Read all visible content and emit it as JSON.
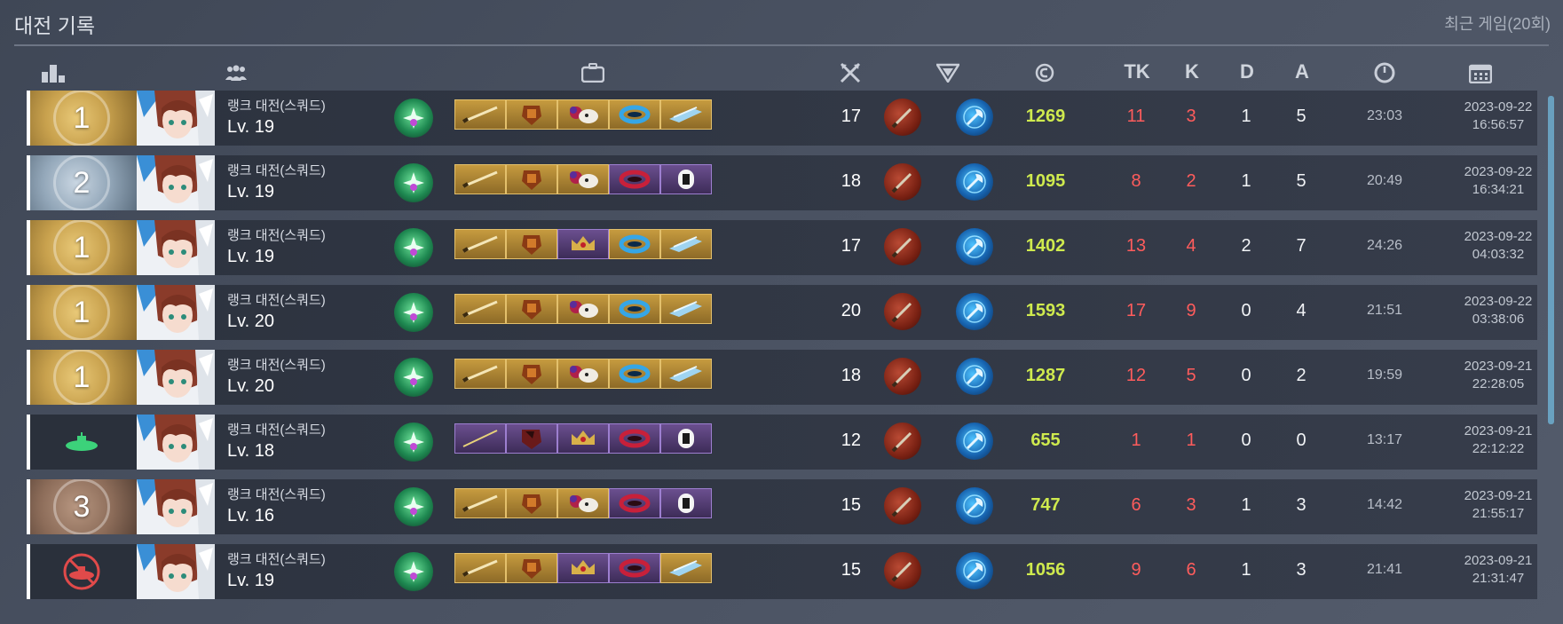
{
  "title": "대전 기록",
  "recent": "최근 게임(20회)",
  "headers": {
    "rank_icon": "rank-podium-icon",
    "players_icon": "team-icon",
    "items_icon": "briefcase-icon",
    "tier_icon": "crossed-swords-icon",
    "weapon_icon": "emblem-icon",
    "credit_icon": "credit-icon",
    "tk": "TK",
    "k": "K",
    "d": "D",
    "a": "A",
    "time_icon": "clock-icon",
    "date_icon": "calendar-icon"
  },
  "colors": {
    "credit": "#cfea4e",
    "kill": "#ff5c5c",
    "gold_rank": "#c9a24e",
    "silver_rank": "#93a7b9",
    "bronze_rank": "#8c6c59",
    "win_sub": "#3cd27a",
    "lose_sub": "#e04a4a"
  },
  "rows": [
    {
      "rank": "1",
      "rank_style": "gold",
      "mode": "랭크 대전(스쿼드)",
      "level": "Lv. 19",
      "items": [
        "gold",
        "gold",
        "gold",
        "gold",
        "gold"
      ],
      "tier": "17",
      "credit": "1269",
      "tk": "11",
      "k": "3",
      "d": "1",
      "a": "5",
      "time": "23:03",
      "date": "2023-09-22",
      "clock": "16:56:57"
    },
    {
      "rank": "2",
      "rank_style": "silver",
      "mode": "랭크 대전(스쿼드)",
      "level": "Lv. 19",
      "items": [
        "gold",
        "gold",
        "gold",
        "purple",
        "purple"
      ],
      "tier": "18",
      "credit": "1095",
      "tk": "8",
      "k": "2",
      "d": "1",
      "a": "5",
      "time": "20:49",
      "date": "2023-09-22",
      "clock": "16:34:21"
    },
    {
      "rank": "1",
      "rank_style": "gold",
      "mode": "랭크 대전(스쿼드)",
      "level": "Lv. 19",
      "items": [
        "gold",
        "gold",
        "purple",
        "gold",
        "gold"
      ],
      "tier": "17",
      "credit": "1402",
      "tk": "13",
      "k": "4",
      "d": "2",
      "a": "7",
      "time": "24:26",
      "date": "2023-09-22",
      "clock": "04:03:32"
    },
    {
      "rank": "1",
      "rank_style": "gold",
      "mode": "랭크 대전(스쿼드)",
      "level": "Lv. 20",
      "items": [
        "gold",
        "gold",
        "gold",
        "gold",
        "gold"
      ],
      "tier": "20",
      "credit": "1593",
      "tk": "17",
      "k": "9",
      "d": "0",
      "a": "4",
      "time": "21:51",
      "date": "2023-09-22",
      "clock": "03:38:06"
    },
    {
      "rank": "1",
      "rank_style": "gold",
      "mode": "랭크 대전(스쿼드)",
      "level": "Lv. 20",
      "items": [
        "gold",
        "gold",
        "gold",
        "gold",
        "gold"
      ],
      "tier": "18",
      "credit": "1287",
      "tk": "12",
      "k": "5",
      "d": "0",
      "a": "2",
      "time": "19:59",
      "date": "2023-09-21",
      "clock": "22:28:05"
    },
    {
      "rank": "",
      "rank_style": "dark-green",
      "mode": "랭크 대전(스쿼드)",
      "level": "Lv. 18",
      "items": [
        "purple",
        "purple",
        "purple",
        "purple",
        "purple"
      ],
      "tier": "12",
      "credit": "655",
      "tk": "1",
      "k": "1",
      "d": "0",
      "a": "0",
      "time": "13:17",
      "date": "2023-09-21",
      "clock": "22:12:22"
    },
    {
      "rank": "3",
      "rank_style": "bronze",
      "mode": "랭크 대전(스쿼드)",
      "level": "Lv. 16",
      "items": [
        "gold",
        "gold",
        "gold",
        "purple",
        "purple"
      ],
      "tier": "15",
      "credit": "747",
      "tk": "6",
      "k": "3",
      "d": "1",
      "a": "3",
      "time": "14:42",
      "date": "2023-09-21",
      "clock": "21:55:17"
    },
    {
      "rank": "",
      "rank_style": "dark-red",
      "mode": "랭크 대전(스쿼드)",
      "level": "Lv. 19",
      "items": [
        "gold",
        "gold",
        "purple",
        "purple",
        "gold"
      ],
      "tier": "15",
      "credit": "1056",
      "tk": "9",
      "k": "6",
      "d": "1",
      "a": "3",
      "time": "21:41",
      "date": "2023-09-21",
      "clock": "21:31:47"
    }
  ]
}
